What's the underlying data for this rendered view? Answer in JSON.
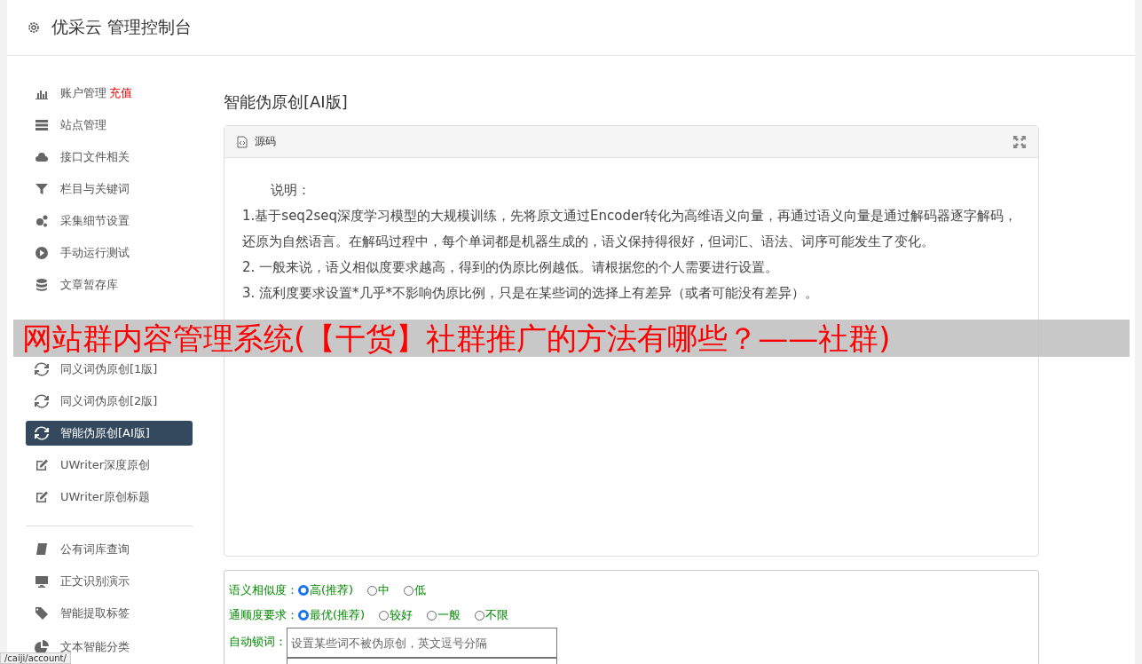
{
  "header": {
    "title": "优采云 管理控制台"
  },
  "sidebar": {
    "groups": [
      {
        "items": [
          {
            "label": "账户管理",
            "badge": "充值",
            "selected": false
          },
          {
            "label": "站点管理",
            "selected": false
          },
          {
            "label": "接口文件相关",
            "selected": false
          },
          {
            "label": "栏目与关键词",
            "selected": false
          },
          {
            "label": "采集细节设置",
            "selected": false
          },
          {
            "label": "手动运行测试",
            "selected": false
          },
          {
            "label": "文章暂存库",
            "selected": false
          }
        ]
      },
      {
        "items": [
          {
            "label": "同义词伪原创[1版]",
            "selected": false
          },
          {
            "label": "同义词伪原创[2版]",
            "selected": false
          },
          {
            "label": "智能伪原创[AI版]",
            "selected": true
          },
          {
            "label": "UWriter深度原创",
            "selected": false
          },
          {
            "label": "UWriter原创标题",
            "selected": false
          }
        ]
      },
      {
        "items": [
          {
            "label": "公有词库查询",
            "selected": false
          },
          {
            "label": "正文识别演示",
            "selected": false
          },
          {
            "label": "智能提取标签",
            "selected": false
          },
          {
            "label": "文本智能分类",
            "selected": false
          }
        ]
      }
    ]
  },
  "page_title": "智能伪原创[AI版]",
  "editor": {
    "tab": "源码",
    "lines": [
      "说明：",
      "1.基于seq2seq深度学习模型的大规模训练，先将原文通过Encoder转化为高维语义向量，再通过语义向量是通过解码器逐字解码，还原为自然语言。在解码过程中，每个单词都是机器生成的，语义保持得很好，但词汇、语法、词序可能发生了变化。",
      "2. 一般来说，语义相似度要求越高，得到的伪原比例越低。请根据您的个人需要进行设置。",
      "3. 流利度要求设置*几乎*不影响伪原比例，只是在某些词的选择上有差异（或者可能没有差异）。"
    ]
  },
  "form": {
    "similarity": {
      "label": "语义相似度：",
      "options": [
        {
          "label": "高(推荐)",
          "selected": true
        },
        {
          "label": "中",
          "selected": false
        },
        {
          "label": "低",
          "selected": false
        }
      ]
    },
    "fluency": {
      "label": "通顺度要求：",
      "options": [
        {
          "label": "最优(推荐)",
          "selected": true
        },
        {
          "label": "较好",
          "selected": false
        },
        {
          "label": "一般",
          "selected": false
        },
        {
          "label": "不限",
          "selected": false
        }
      ]
    },
    "lock_words": {
      "label": "自动锁词：",
      "placeholder": "设置某些词不被伪原创，英文逗号分隔"
    }
  },
  "overlay_banner": "网站群内容管理系统(【干货】社群推广的方法有哪些？——社群)",
  "status_url": "/caiji/account/"
}
